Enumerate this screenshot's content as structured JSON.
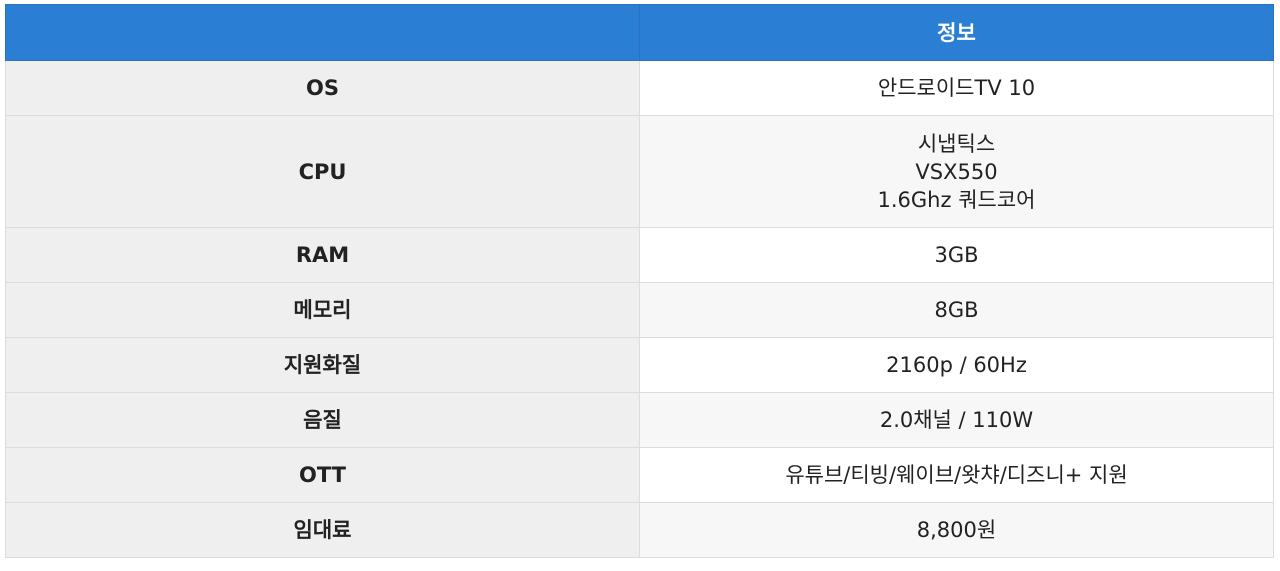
{
  "table": {
    "header": [
      "",
      "정보"
    ],
    "rows": [
      {
        "key": "OS",
        "value": [
          "안드로이드TV 10"
        ]
      },
      {
        "key": "CPU",
        "value": [
          "시냅틱스",
          "VSX550",
          "1.6Ghz 쿼드코어"
        ]
      },
      {
        "key": "RAM",
        "value": [
          "3GB"
        ]
      },
      {
        "key": "메모리",
        "value": [
          "8GB"
        ]
      },
      {
        "key": "지원화질",
        "value": [
          "2160p / 60Hz"
        ]
      },
      {
        "key": "음질",
        "value": [
          "2.0채널 / 110W"
        ]
      },
      {
        "key": "OTT",
        "value": [
          "유튜브/티빙/웨이브/왓챠/디즈니+ 지원"
        ]
      },
      {
        "key": "임대료",
        "value": [
          "8,800원"
        ]
      }
    ]
  },
  "colors": {
    "header_bg": "#2a7fd4",
    "key_bg": "#efefef",
    "alt_row_bg": "#f7f7f7",
    "border": "#dcdcdc"
  }
}
